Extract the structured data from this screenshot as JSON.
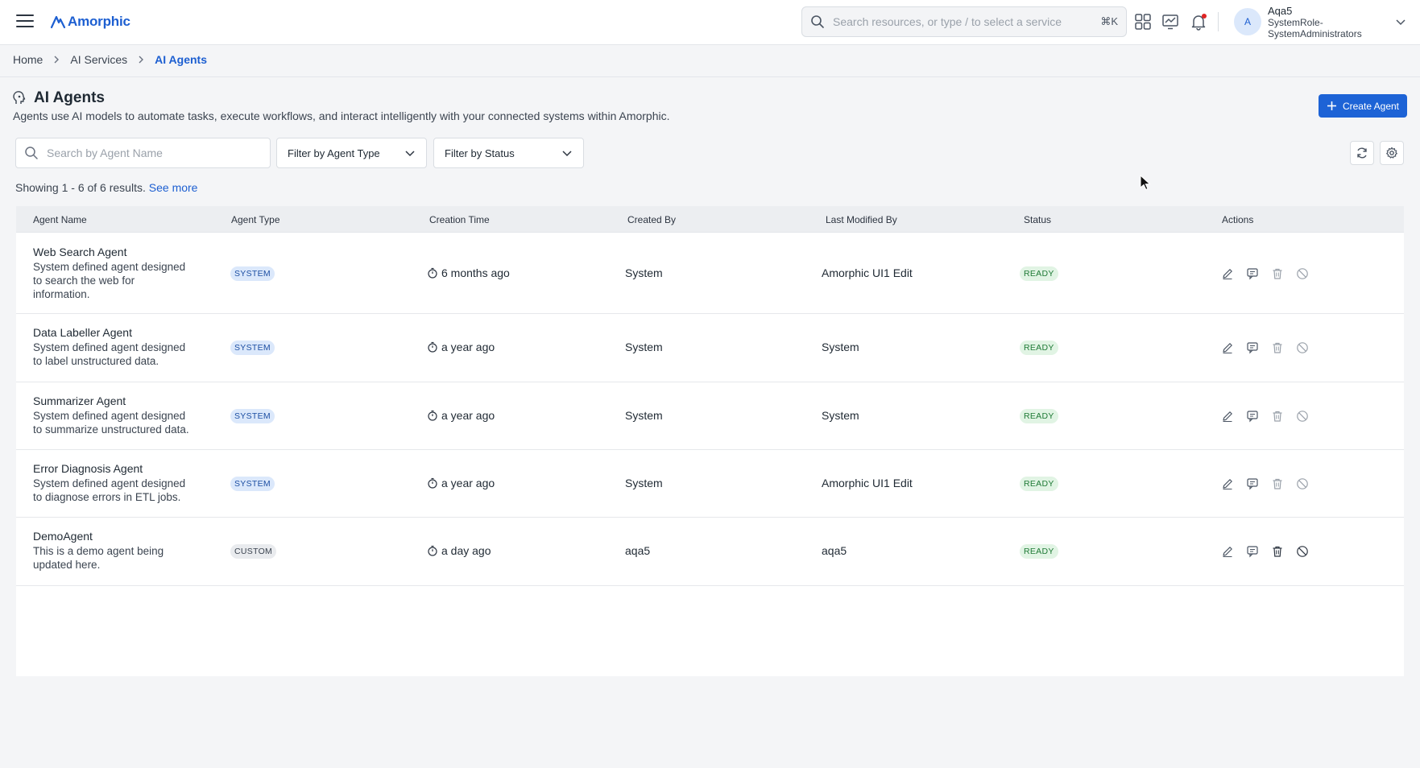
{
  "app": {
    "logo_text": "Amorphic"
  },
  "header": {
    "search_placeholder": "Search resources, or type / to select a service",
    "search_shortcut": "⌘K",
    "icons": [
      "apps-grid-icon",
      "dashboard-chart-icon",
      "bell-icon"
    ],
    "user": {
      "avatar_initial": "A",
      "name": "Aqa5",
      "role_line1": "SystemRole-",
      "role_line2": "SystemAdministrators"
    }
  },
  "breadcrumb": {
    "items": [
      "Home",
      "AI Services"
    ],
    "current": "AI Agents"
  },
  "page": {
    "title": "AI Agents",
    "description": "Agents use AI models to automate tasks, execute workflows, and interact intelligently with your connected systems within Amorphic.",
    "create_button": "Create Agent"
  },
  "filters": {
    "search_placeholder": "Search by Agent Name",
    "agent_type_label": "Filter by Agent Type",
    "status_label": "Filter by Status"
  },
  "results": {
    "text": "Showing 1 - 6 of 6 results.",
    "link": "See more"
  },
  "table": {
    "columns": [
      "Agent Name",
      "Agent Type",
      "Creation Time",
      "Created By",
      "Last Modified By",
      "Status",
      "Actions"
    ],
    "rows": [
      {
        "name": "Web Search Agent",
        "description": "System defined agent designed to search the web for information.",
        "type": "SYSTEM",
        "created": "6 months ago",
        "created_by": "System",
        "modified_by": "Amorphic UI1 Edit",
        "status": "READY"
      },
      {
        "name": "Data Labeller Agent",
        "description": "System defined agent designed to label unstructured data.",
        "type": "SYSTEM",
        "created": "a year ago",
        "created_by": "System",
        "modified_by": "System",
        "status": "READY"
      },
      {
        "name": "Summarizer Agent",
        "description": "System defined agent designed to summarize unstructured data.",
        "type": "SYSTEM",
        "created": "a year ago",
        "created_by": "System",
        "modified_by": "System",
        "status": "READY"
      },
      {
        "name": "Error Diagnosis Agent",
        "description": "System defined agent designed to diagnose errors in ETL jobs.",
        "type": "SYSTEM",
        "created": "a year ago",
        "created_by": "System",
        "modified_by": "Amorphic UI1 Edit",
        "status": "READY"
      },
      {
        "name": "DemoAgent",
        "description": "This is a demo agent being updated here.",
        "type": "CUSTOM",
        "created": "a day ago",
        "created_by": "aqa5",
        "modified_by": "aqa5",
        "status": "READY"
      }
    ],
    "row_actions": [
      "edit-icon",
      "chat-icon",
      "delete-icon",
      "disable-icon"
    ]
  },
  "colors": {
    "primary": "#1d63d6",
    "ready_bg": "#e1f4e4",
    "ready_text": "#1f7a36",
    "system_badge_bg": "#dbe8fb"
  }
}
